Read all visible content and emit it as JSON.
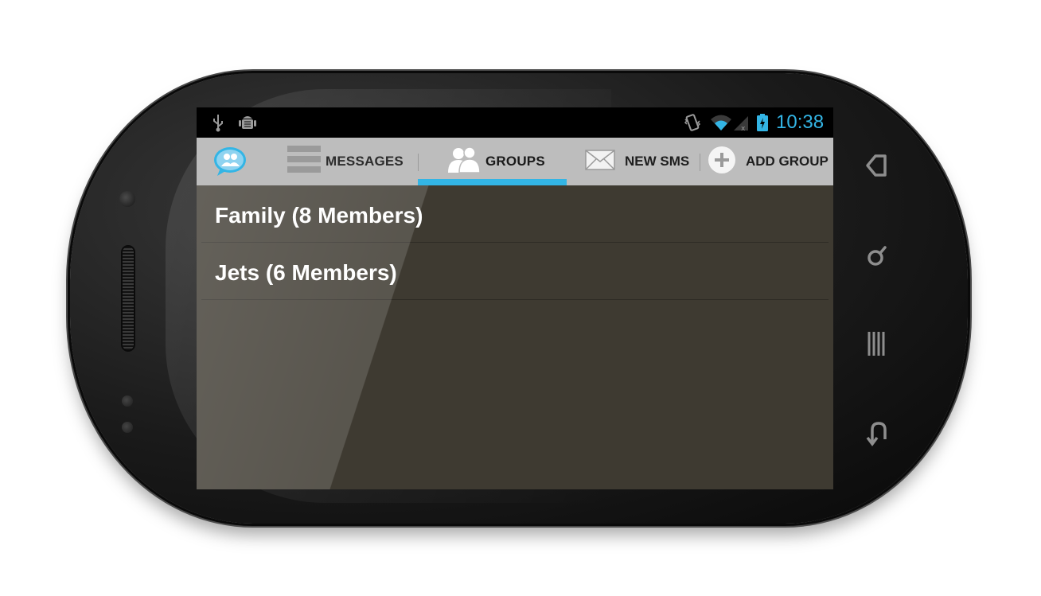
{
  "status_bar": {
    "clock": "10:38",
    "icons": [
      "usb-icon",
      "android-debug-icon",
      "vibrate-icon",
      "wifi-icon",
      "signal-icon",
      "battery-charging-icon"
    ]
  },
  "action_bar": {
    "app_icon": "chat-bubble-people-icon",
    "tabs": [
      {
        "label": "MESSAGES",
        "icon": "list-icon",
        "selected": false
      },
      {
        "label": "GROUPS",
        "icon": "people-icon",
        "selected": true
      }
    ],
    "actions": [
      {
        "label": "NEW SMS",
        "icon": "envelope-icon"
      },
      {
        "label": "ADD GROUP",
        "icon": "plus-circle-icon"
      }
    ],
    "accent_color": "#33b5e5"
  },
  "groups": [
    {
      "label": "Family (8 Members)"
    },
    {
      "label": "Jets (6 Members)"
    }
  ],
  "soft_keys": [
    "home-icon",
    "search-icon",
    "menu-icon",
    "back-icon"
  ]
}
